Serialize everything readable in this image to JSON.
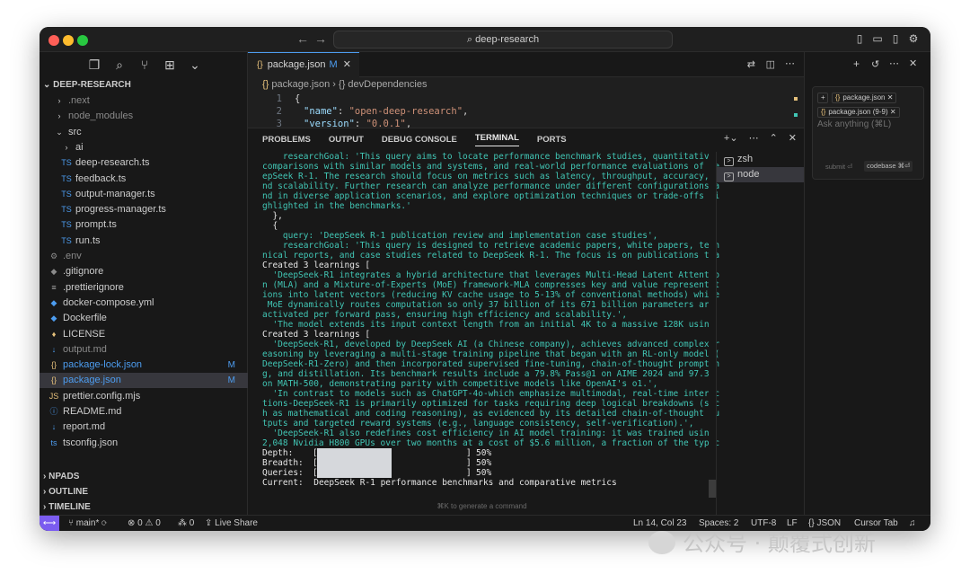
{
  "titlebar": {
    "search": "deep-research"
  },
  "explorer": {
    "root": "DEEP-RESEARCH",
    "items": [
      {
        "label": ".next",
        "kind": "folder",
        "dim": true
      },
      {
        "label": "node_modules",
        "kind": "folder",
        "dim": true
      },
      {
        "label": "src",
        "kind": "folder-open"
      },
      {
        "label": "ai",
        "kind": "folder"
      },
      {
        "label": "deep-research.ts",
        "kind": "ts"
      },
      {
        "label": "feedback.ts",
        "kind": "ts"
      },
      {
        "label": "output-manager.ts",
        "kind": "ts"
      },
      {
        "label": "progress-manager.ts",
        "kind": "ts"
      },
      {
        "label": "prompt.ts",
        "kind": "ts"
      },
      {
        "label": "run.ts",
        "kind": "ts"
      },
      {
        "label": ".env",
        "kind": "gear",
        "dim": true
      },
      {
        "label": ".gitignore",
        "kind": "git"
      },
      {
        "label": ".prettierignore",
        "kind": "file"
      },
      {
        "label": "docker-compose.yml",
        "kind": "docker"
      },
      {
        "label": "Dockerfile",
        "kind": "docker"
      },
      {
        "label": "LICENSE",
        "kind": "license"
      },
      {
        "label": "output.md",
        "kind": "md",
        "dim": true
      },
      {
        "label": "package-lock.json",
        "kind": "json",
        "mod": "M"
      },
      {
        "label": "package.json",
        "kind": "json",
        "mod": "M"
      },
      {
        "label": "prettier.config.mjs",
        "kind": "js"
      },
      {
        "label": "README.md",
        "kind": "info"
      },
      {
        "label": "report.md",
        "kind": "md"
      },
      {
        "label": "tsconfig.json",
        "kind": "tsconfig"
      }
    ],
    "sections": [
      "NPADS",
      "OUTLINE",
      "TIMELINE"
    ]
  },
  "editor": {
    "tab": {
      "label": "package.json",
      "mod": "M"
    },
    "breadcrumb": [
      "package.json",
      "devDependencies"
    ],
    "lines": [
      {
        "n": "1",
        "text": "{"
      },
      {
        "n": "2",
        "key": "\"name\"",
        "val": "\"open-deep-research\""
      },
      {
        "n": "3",
        "key": "\"version\"",
        "val": "\"0.0.1\""
      }
    ]
  },
  "panel": {
    "tabs": [
      "PROBLEMS",
      "OUTPUT",
      "DEBUG CONSOLE",
      "TERMINAL",
      "PORTS"
    ],
    "active_tab": "TERMINAL",
    "terminal_lines": [
      {
        "t": "    researchGoal: 'This query aims to locate performance benchmark studies, quantitative",
        "c": true,
        "prefix": "    researchGoal: "
      },
      {
        "t": "comparisons with similar models and systems, and real-world performance evaluations of De",
        "c": true
      },
      {
        "t": "epSeek R-1. The research should focus on metrics such as latency, throughput, accuracy, a",
        "c": true
      },
      {
        "t": "nd scalability. Further research can analyze performance under different configurations a",
        "c": true
      },
      {
        "t": "nd in diverse application scenarios, and explore optimization techniques or trade-offs hi",
        "c": true
      },
      {
        "t": "ghlighted in the benchmarks.'",
        "c": true
      },
      {
        "t": "  },",
        "c": false
      },
      {
        "t": "  {",
        "c": false
      },
      {
        "t": "    query: 'DeepSeek R-1 publication review and implementation case studies',",
        "c": true
      },
      {
        "t": "    researchGoal: 'This query is designed to retrieve academic papers, white papers, tech",
        "c": true
      },
      {
        "t": "nical reports, and case studies related to DeepSeek R-1. The focus is on publications tha",
        "c": true
      },
      {
        "t": "Created 3 learnings [",
        "c": false
      },
      {
        "t": "  'DeepSeek-R1 integrates a hybrid architecture that leverages Multi-Head Latent Attentio",
        "c": true
      },
      {
        "t": "n (MLA) and a Mixture-of-Experts (MoE) framework-MLA compresses key and value representat",
        "c": true
      },
      {
        "t": "ions into latent vectors (reducing KV cache usage to 5-13% of conventional methods) while",
        "c": true
      },
      {
        "t": " MoE dynamically routes computation so only 37 billion of its 671 billion parameters are",
        "c": true
      },
      {
        "t": "activated per forward pass, ensuring high efficiency and scalability.',",
        "c": true
      },
      {
        "t": "  'The model extends its input context length from an initial 4K to a massive 128K using",
        "c": true
      },
      {
        "t": "Created 3 learnings [",
        "c": false
      },
      {
        "t": "  'DeepSeek-R1, developed by DeepSeek AI (a Chinese company), achieves advanced complex r",
        "c": true
      },
      {
        "t": "easoning by leveraging a multi-stage training pipeline that began with an RL-only model (",
        "c": true
      },
      {
        "t": "DeepSeek-R1-Zero) and then incorporated supervised fine-tuning, chain-of-thought promptin",
        "c": true
      },
      {
        "t": "g, and distillation. Its benchmark results include a 79.8% Pass@1 on AIME 2024 and 97.3%",
        "c": true
      },
      {
        "t": "on MATH-500, demonstrating parity with competitive models like OpenAI's o1.',",
        "c": true
      },
      {
        "t": "  'In contrast to models such as ChatGPT-4o-which emphasize multimodal, real-time interac",
        "c": true
      },
      {
        "t": "tions-DeepSeek-R1 is primarily optimized for tasks requiring deep logical breakdowns (suc",
        "c": true
      },
      {
        "t": "h as mathematical and coding reasoning), as evidenced by its detailed chain-of-thought ou",
        "c": true
      },
      {
        "t": "tputs and targeted reward systems (e.g., language consistency, self-verification).',",
        "c": true
      },
      {
        "t": "  'DeepSeek-R1 also redefines cost efficiency in AI model training: it was trained using",
        "c": true
      },
      {
        "t": "2,048 Nvidia H800 GPUs over two months at a cost of $5.6 million, a fraction of the typic",
        "c": true
      }
    ],
    "progress": [
      {
        "label": "Depth:",
        "pct": "50%",
        "value": 0.5
      },
      {
        "label": "Breadth:",
        "pct": "50%",
        "value": 0.5
      },
      {
        "label": "Queries:",
        "pct": "50%",
        "value": 0.5
      }
    ],
    "current": {
      "label": "Current:",
      "value": "DeepSeek R-1 performance benchmarks and comparative metrics"
    },
    "cmdk_hint": "⌘K to generate a command",
    "terminals": [
      "zsh",
      "node"
    ]
  },
  "chat": {
    "chips": [
      "package.json",
      "package.json (9-9)"
    ],
    "placeholder": "Ask anything (⌘L)",
    "submit": "submit ⏎",
    "codebase": "codebase ⌘⏎"
  },
  "statusbar": {
    "branch": "main*",
    "problems": "⊗ 0 ⚠ 0",
    "ports": "⁂ 0",
    "liveshare": "Live Share",
    "position": "Ln 14, Col 23",
    "spaces": "Spaces: 2",
    "encoding": "UTF-8",
    "eol": "LF",
    "language": "{} JSON",
    "tab": "Cursor Tab"
  },
  "watermark": "公众号 · 颠覆式创新"
}
